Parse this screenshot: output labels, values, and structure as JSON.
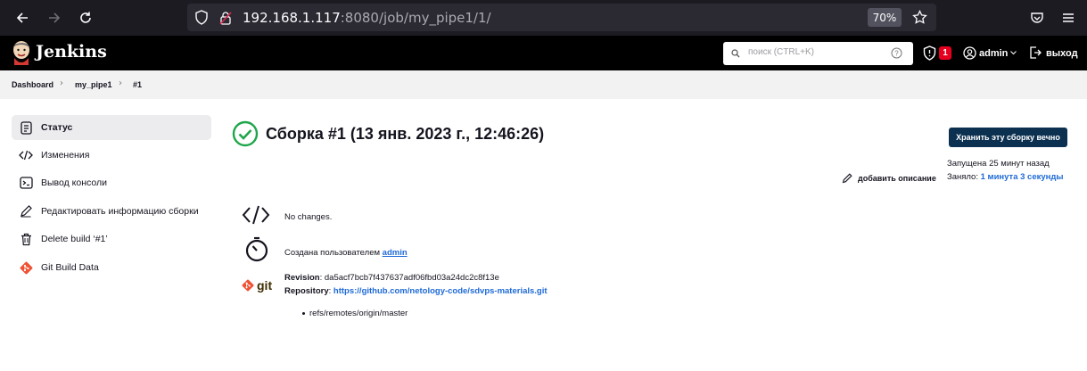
{
  "browser": {
    "url_host": "192.168.1.117",
    "url_rest": ":8080/job/my_pipe1/1/",
    "zoom": "70%"
  },
  "header": {
    "logo": "Jenkins",
    "search_placeholder": "поиск (CTRL+K)",
    "alert_count": "1",
    "user": "admin",
    "logout": "выход"
  },
  "breadcrumb": [
    "Dashboard",
    "my_pipe1",
    "#1"
  ],
  "sidebar": {
    "items": [
      {
        "label": "Статус",
        "icon": "document-icon"
      },
      {
        "label": "Изменения",
        "icon": "code-icon"
      },
      {
        "label": "Вывод консоли",
        "icon": "terminal-icon"
      },
      {
        "label": "Редактировать информацию сборки",
        "icon": "edit-icon"
      },
      {
        "label": "Delete build ‘#1’",
        "icon": "trash-icon"
      },
      {
        "label": "Git Build Data",
        "icon": "git-icon"
      }
    ]
  },
  "main": {
    "title": "Сборка #1 (13 янв. 2023 г., 12:46:26)",
    "keep_button": "Хранить эту сборку вечно",
    "started": "Запущена 25 минут назад",
    "took_label": "Заняло: ",
    "took_value": "1 минута 3 секунды",
    "add_description": "добавить описание",
    "no_changes": "No changes.",
    "created_by_prefix": "Создана пользователем ",
    "created_by_user": "admin",
    "revision_label": "Revision",
    "revision_value": ": da5acf7bcb7f437637adf06fbd03a24dc2c8f13e",
    "repository_label": "Repository",
    "repository_sep": ": ",
    "repository_value": "https://github.com/netology-code/sdvps-materials.git",
    "branch": "refs/remotes/origin/master",
    "git_logo_text": "git"
  },
  "colors": {
    "accent": "#1e6ad6",
    "keep_button": "#0c3050",
    "success": "#1ea64b"
  }
}
